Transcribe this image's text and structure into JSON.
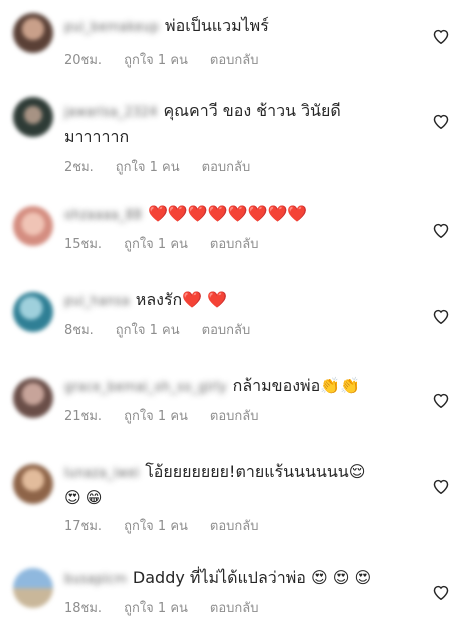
{
  "comments": [
    {
      "username": "pui_bemakeup",
      "lines": [
        "พ่อเป็นแวมไพร์"
      ],
      "time": "20ชม.",
      "likes": "ถูกใจ 1 คน",
      "reply": "ตอบกลับ",
      "avatar_color": "#7a5a4a"
    },
    {
      "username": "jawarisa_2324",
      "lines": [
        "คุณคาวี ของ ช้าวน วินัยดี",
        "มาาาาาก"
      ],
      "time": "2ชม.",
      "likes": "ถูกใจ 1 คน",
      "reply": "ตอบกลับ",
      "avatar_color": "#3e4a44"
    },
    {
      "username": "ohzaaaa_88",
      "lines": [
        "❤️❤️❤️❤️❤️❤️❤️❤️"
      ],
      "time": "15ชม.",
      "likes": "ถูกใจ 1 คน",
      "reply": "ตอบกลับ",
      "avatar_color": "#d99a8c"
    },
    {
      "username": "pui_hansa",
      "lines": [
        "หลงรัก❤️ ❤️"
      ],
      "time": "8ชม.",
      "likes": "ถูกใจ 1 คน",
      "reply": "ตอบกลับ",
      "avatar_color": "#4a8fa0"
    },
    {
      "username": "grace_bemai_oh_so_girly",
      "lines": [
        "กล้ามของพ่อ👏👏"
      ],
      "time": "21ชม.",
      "likes": "ถูกใจ 1 คน",
      "reply": "ตอบกลับ",
      "avatar_color": "#8a6c64"
    },
    {
      "username": "lunaza_iwei",
      "lines": [
        "โอ้ยยยยยยย!ตายแร้นนนนนน😌",
        "😍 😁"
      ],
      "time": "17ชม.",
      "likes": "ถูกใจ 1 คน",
      "reply": "ตอบกลับ",
      "avatar_color": "#b48a6a"
    },
    {
      "username": "busapicm",
      "lines": [
        "Daddy ที่ไม่ได้แปลว่าพ่อ 😍 😍 😍"
      ],
      "time": "18ชม.",
      "likes": "ถูกใจ 1 คน",
      "reply": "ตอบกลับ",
      "avatar_color": "#5e8cb4"
    }
  ],
  "colors": {
    "text": "#262626",
    "meta": "#8e8e8e",
    "heart_outline": "#262626"
  }
}
